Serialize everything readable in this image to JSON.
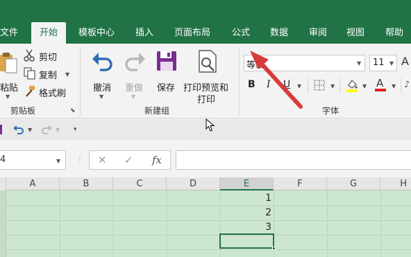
{
  "menubar": {
    "tabs": [
      "文件",
      "开始",
      "模板中心",
      "插入",
      "页面布局",
      "公式",
      "数据",
      "审阅",
      "视图",
      "帮助"
    ],
    "active_tab": "开始"
  },
  "clipboard": {
    "paste_label": "粘贴",
    "cut_label": "剪切",
    "copy_label": "复制",
    "format_painter_label": "格式刷",
    "group_label": "剪贴板"
  },
  "newgroup": {
    "undo_label": "撤消",
    "redo_label": "重做",
    "save_label": "保存",
    "print_preview_label_line1": "打印预览和",
    "print_preview_label_line2": "打印",
    "group_label": "新建组"
  },
  "font": {
    "font_name": "等线",
    "font_size": "11",
    "bold_label": "B",
    "italic_label": "I",
    "underline_label": "U",
    "font_color_label": "A",
    "group_label": "字体"
  },
  "formula_bar": {
    "namebox_value": "4",
    "cancel_symbol": "✕",
    "enter_symbol": "✓",
    "fx_label": "fx",
    "content": ""
  },
  "grid": {
    "columns": [
      "A",
      "B",
      "C",
      "D",
      "E",
      "F",
      "G",
      "H"
    ],
    "selected_column": "E",
    "cells": [
      "1",
      "2",
      "3"
    ]
  },
  "colors": {
    "brand_green": "#217346",
    "sheet_tint": "#cde6cf",
    "arrow_red": "#d93b3b"
  }
}
